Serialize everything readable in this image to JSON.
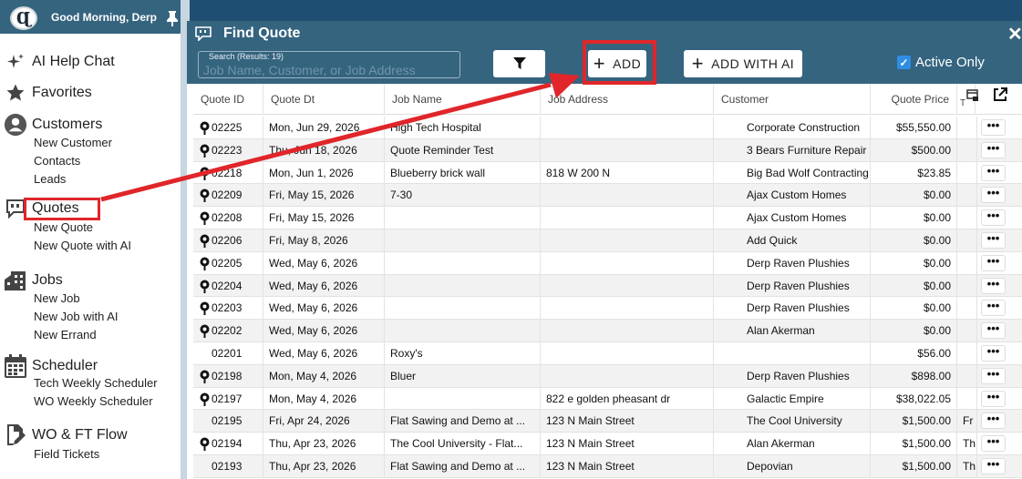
{
  "app": {
    "greeting": "Good Morning, Derp",
    "logo_text": "Ɋ"
  },
  "sidebar": {
    "ai_help": "AI Help Chat",
    "favorites": "Favorites",
    "customers": {
      "label": "Customers",
      "items": [
        "New Customer",
        "Contacts",
        "Leads"
      ]
    },
    "quotes": {
      "label": "Quotes",
      "items": [
        "New Quote",
        "New Quote with AI"
      ]
    },
    "jobs": {
      "label": "Jobs",
      "items": [
        "New Job",
        "New Job with AI",
        "New Errand"
      ]
    },
    "scheduler": {
      "label": "Scheduler",
      "items": [
        "Tech Weekly Scheduler",
        "WO Weekly Scheduler"
      ]
    },
    "wo_flow": {
      "label": "WO & FT Flow",
      "items": [
        "Field Tickets"
      ]
    }
  },
  "panel": {
    "title": "Find Quote",
    "search_label": "Search (Results: 19)",
    "search_placeholder": "Job Name, Customer, or Job Address",
    "add_label": "ADD",
    "add_ai_label": "ADD WITH AI",
    "active_only_label": "Active Only",
    "active_only_checked": true
  },
  "table": {
    "columns": [
      "Quote ID",
      "Quote Dt",
      "Job Name",
      "Job Address",
      "Customer",
      "Quote Price",
      "T"
    ],
    "rows": [
      {
        "id": "02225",
        "date": "Mon, Jun 29, 2026",
        "job": "High Tech Hospital",
        "address": "",
        "customer": "Corporate Construction",
        "icon": true,
        "price": "$55,550.00",
        "t": ""
      },
      {
        "id": "02223",
        "date": "Thu, Jun 18, 2026",
        "job": "Quote Reminder Test",
        "address": "",
        "customer": "3 Bears Furniture Repair",
        "icon": true,
        "price": "$500.00",
        "t": ""
      },
      {
        "id": "02218",
        "date": "Mon, Jun 1, 2026",
        "job": "Blueberry brick wall",
        "address": "818 W 200 N",
        "customer": "Big Bad Wolf Contracting",
        "icon": true,
        "price": "$23.85",
        "t": ""
      },
      {
        "id": "02209",
        "date": "Fri, May 15, 2026",
        "job": "7-30",
        "address": "",
        "customer": "Ajax Custom Homes",
        "icon": true,
        "price": "$0.00",
        "t": ""
      },
      {
        "id": "02208",
        "date": "Fri, May 15, 2026",
        "job": "",
        "address": "",
        "customer": "Ajax Custom Homes",
        "icon": true,
        "price": "$0.00",
        "t": ""
      },
      {
        "id": "02206",
        "date": "Fri, May 8, 2026",
        "job": "",
        "address": "",
        "customer": "Add Quick",
        "icon": true,
        "price": "$0.00",
        "t": ""
      },
      {
        "id": "02205",
        "date": "Wed, May 6, 2026",
        "job": "",
        "address": "",
        "customer": "Derp Raven Plushies",
        "icon": true,
        "price": "$0.00",
        "t": ""
      },
      {
        "id": "02204",
        "date": "Wed, May 6, 2026",
        "job": "",
        "address": "",
        "customer": "Derp Raven Plushies",
        "icon": true,
        "price": "$0.00",
        "t": ""
      },
      {
        "id": "02203",
        "date": "Wed, May 6, 2026",
        "job": "",
        "address": "",
        "customer": "Derp Raven Plushies",
        "icon": true,
        "price": "$0.00",
        "t": ""
      },
      {
        "id": "02202",
        "date": "Wed, May 6, 2026",
        "job": "",
        "address": "",
        "customer": "Alan Akerman",
        "icon": true,
        "price": "$0.00",
        "t": ""
      },
      {
        "id": "02201",
        "date": "Wed, May 6, 2026",
        "job": "Roxy's",
        "address": "",
        "customer": "",
        "icon": false,
        "price": "$56.00",
        "t": ""
      },
      {
        "id": "02198",
        "date": "Mon, May 4, 2026",
        "job": "Bluer",
        "address": "",
        "customer": "Derp Raven Plushies",
        "icon": true,
        "price": "$898.00",
        "t": ""
      },
      {
        "id": "02197",
        "date": "Mon, May 4, 2026",
        "job": "",
        "address": "822 e golden pheasant dr",
        "customer": "Galactic Empire",
        "icon": true,
        "price": "$38,022.05",
        "t": ""
      },
      {
        "id": "02195",
        "date": "Fri, Apr 24, 2026",
        "job": "Flat Sawing and Demo at ...",
        "address": "123 N Main Street",
        "customer": "The Cool University",
        "icon": false,
        "price": "$1,500.00",
        "t": "Fr"
      },
      {
        "id": "02194",
        "date": "Thu, Apr 23, 2026",
        "job": "The Cool University - Flat...",
        "address": "123 N Main Street",
        "customer": "Alan Akerman",
        "icon": true,
        "price": "$1,500.00",
        "t": "Th"
      },
      {
        "id": "02193",
        "date": "Thu, Apr 23, 2026",
        "job": "Flat Sawing and Demo at ...",
        "address": "123 N Main Street",
        "customer": "Depovian",
        "icon": false,
        "price": "$1,500.00",
        "t": "Th"
      }
    ]
  },
  "colors": {
    "header_bg": "#35647f",
    "highlight": "#e0262a",
    "checkbox": "#2f8de4"
  }
}
